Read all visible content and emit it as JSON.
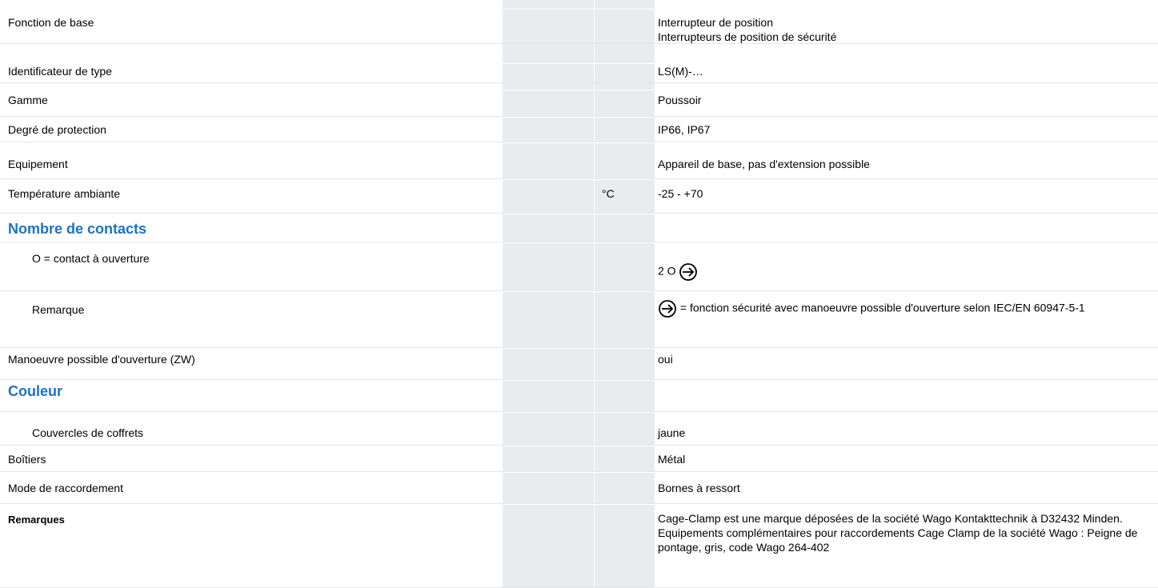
{
  "rows": [
    {
      "label": "Fonction de base",
      "unit": "",
      "values": [
        "Interrupteur de position",
        "Interrupteurs de position de sécurité"
      ]
    },
    {
      "label": "Identificateur de type",
      "unit": "",
      "values": [
        "LS(M)-…"
      ]
    },
    {
      "label": "Gamme",
      "unit": "",
      "values": [
        "Poussoir"
      ]
    },
    {
      "label": "Degré de protection",
      "unit": "",
      "values": [
        "IP66, IP67"
      ]
    },
    {
      "label": "Equipement",
      "unit": "",
      "values": [
        "Appareil de base, pas d'extension possible"
      ]
    },
    {
      "label": "Température ambiante",
      "unit": "°C",
      "values": [
        "-25 - +70"
      ]
    }
  ],
  "section_contacts": {
    "title": "Nombre de contacts",
    "ouverture_label": "O = contact à ouverture",
    "ouverture_value": "2 O",
    "remarque_label": "Remarque",
    "remarque_value": "= fonction sécurité avec manoeuvre possible d'ouverture selon IEC/EN 60947-5-1"
  },
  "manoeuvre": {
    "label": "Manoeuvre possible d'ouverture (ZW)",
    "value": "oui"
  },
  "section_couleur": {
    "title": "Couleur",
    "couvercles_label": "Couvercles de coffrets",
    "couvercles_value": "jaune"
  },
  "boitiers": {
    "label": "Boîtiers",
    "value": "Métal"
  },
  "raccordement": {
    "label": "Mode de raccordement",
    "value": "Bornes à ressort"
  },
  "remarques": {
    "label": "Remarques",
    "lines": [
      "Cage-Clamp est une marque déposées de la société Wago Kontakttechnik à D32432 Minden.",
      "Equipements complémentaires pour raccordements Cage Clamp de la société Wago : Peigne de pontage, gris, code Wago 264-402"
    ]
  },
  "colors": {
    "heading": "#1a73c6",
    "column_shade": "#e9ebee",
    "row_divider": "#e4e6ea"
  },
  "icons": {
    "safety": "circle-arrow-right-icon"
  }
}
